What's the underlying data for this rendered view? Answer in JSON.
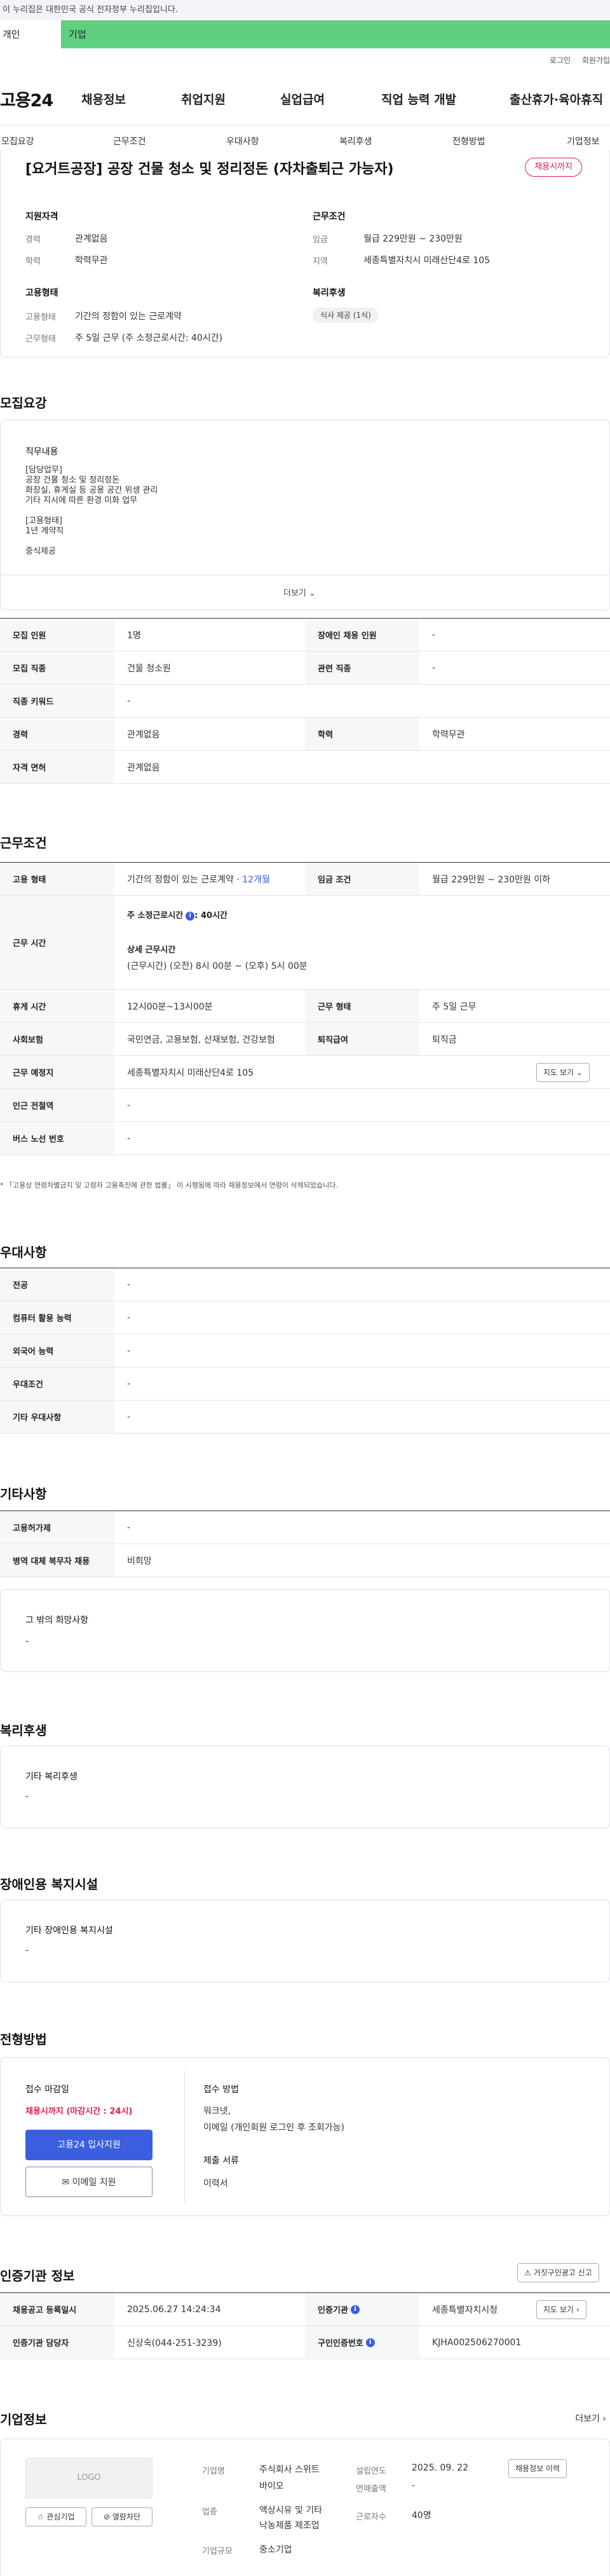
{
  "top": {
    "gov_notice": "이 누리집은 대한민국 공식 전자정부 누리집입니다.",
    "tab_user": "개인",
    "tab_biz": "기업"
  },
  "util": {
    "login": "로그인",
    "join": "회원가입"
  },
  "gnb": {
    "logo": "고용24",
    "items": [
      "채용정보",
      "취업지원",
      "실업급여",
      "직업 능력 개발",
      "출산휴가·육아휴직"
    ]
  },
  "snb": {
    "items": [
      "모집요강",
      "근무조건",
      "우대사항",
      "복리후생",
      "전형방법",
      "기업정보"
    ]
  },
  "summary": {
    "title": "[요거트공장] 공장 건물 청소 및 정리정돈 (자차출퇴근 가능자)",
    "deadline_badge": "채용시까지",
    "qual_label": "지원자격",
    "career_k": "경력",
    "career_v": "관계없음",
    "edu_k": "학력",
    "edu_v": "학력무관",
    "cond_label": "근무조건",
    "wage_k": "임금",
    "wage_v": "월급 229만원 ~ 230만원",
    "area_k": "지역",
    "area_v": "세종특별자치시 미래산단4로 105",
    "emp_label": "고용형태",
    "emptype_k": "고용형태",
    "emptype_v": "기간의 정함이 있는 근로계약",
    "worktype_k": "근무형태",
    "worktype_v": "주 5일 근무 (주 소정근로시간: 40시간)",
    "welfare_label": "복리후생",
    "welfare_chip": "식사 제공 (1식)"
  },
  "recruit": {
    "heading": "모집요강",
    "duty_label": "직무내용",
    "duty_lines": [
      "[담당업무]",
      "공장 건물 청소 및 정리정돈",
      "화장실, 휴게실 등 공용 공간 위생 관리",
      "기타 지시에 따른 환경 미화 업무",
      "",
      "[고용형태]",
      "1년 계약직",
      "",
      "중식제공"
    ],
    "more": "더보기",
    "rows": [
      [
        "모집 인원",
        "1명",
        "장애인 채용 인원",
        "-"
      ],
      [
        "모집 직종",
        "건물 청소원",
        "관련 직종",
        "-"
      ],
      [
        "직종 키워드",
        "-"
      ],
      [
        "경력",
        "관계없음",
        "학력",
        "학력무관"
      ],
      [
        "자격 면허",
        "관계없음"
      ]
    ]
  },
  "work": {
    "heading": "근무조건",
    "emp_k": "고용 형태",
    "emp_v": "기간의 정함이 있는 근로계약 ·",
    "emp_months": "12개월",
    "wage_k": "임금 조건",
    "wage_v": "월급 229만원 ~ 230만원 이하",
    "time_k": "근무 시간",
    "time_weekly": "주 소정근로시간",
    "time_weekly_v": ": 40시간",
    "time_detail_label": "상세 근무시간",
    "time_detail": "(근무시간) (오전) 8시 00분 ~ (오후) 5시 00분",
    "rows": [
      [
        "휴게 시간",
        "12시00분~13시00분",
        "근무 형태",
        "주 5일 근무"
      ],
      [
        "사회보험",
        "국민연금, 고용보험, 산재보험, 건강보험",
        "퇴직급여",
        "퇴직금"
      ]
    ],
    "place_k": "근무 예정지",
    "place_v": "세종특별자치시 미래산단4로 105",
    "map_btn": "지도 보기",
    "rows2": [
      [
        "인근 전철역",
        "-"
      ],
      [
        "버스 노선 번호",
        "-"
      ]
    ],
    "note": "* 「고용상 연령차별금지 및 고령자 고용촉진에 관한 법률」 이 시행됨에 따라 채용정보에서 연령이 삭제되었습니다."
  },
  "pref": {
    "heading": "우대사항",
    "rows": [
      [
        "전공",
        "-"
      ],
      [
        "컴퓨터 활용 능력",
        "-"
      ],
      [
        "외국어 능력",
        "-"
      ],
      [
        "우대조건",
        "-"
      ],
      [
        "기타 우대사항",
        "-"
      ]
    ]
  },
  "etc": {
    "heading": "기타사항",
    "rows": [
      [
        "고용허가제",
        "-"
      ],
      [
        "병역 대체 복무자 채용",
        "비희망"
      ]
    ],
    "other_label": "그 밖의 희망사항",
    "other_v": "-"
  },
  "welfare": {
    "heading": "복리후생",
    "label": "기타 복리후생",
    "value": "-"
  },
  "disab": {
    "heading": "장애인용 복지시설",
    "label": "기타 장애인용 복지시설",
    "value": "-"
  },
  "select": {
    "heading": "전형방법",
    "deadline_label": "접수 마감일",
    "deadline_v": "채용시까지 (마감시간 : 24시)",
    "apply_btn": "고용24 입사지원",
    "email_btn": "이메일 지원",
    "method_label": "접수 방법",
    "method_v1": "워크넷,",
    "method_v2": "이메일 (개인회원 로그인 후 조회가능)",
    "docs_label": "제출 서류",
    "docs_v": "이력서"
  },
  "cert": {
    "heading": "인증기관 정보",
    "report_btn": "거짓구인광고 신고",
    "reg_k": "채용공고 등록일시",
    "reg_v": "2025.06.27 14:24:34",
    "org_k": "인증기관",
    "org_v": "세종특별자치시청",
    "map_btn": "지도 보기",
    "mgr_k": "인증기관 담당자",
    "mgr_v": "신상숙(044-251-3239)",
    "no_k": "구인인증번호",
    "no_v": "KJHA002506270001"
  },
  "company": {
    "heading": "기업정보",
    "more": "더보기",
    "logo": "LOGO",
    "fav_btn": "관심기업",
    "block_btn": "열람차단",
    "name_k": "기업명",
    "name_v1": "주식회사 스위트",
    "name_v2": "바이오",
    "est_k": "설립연도",
    "est_v": "2025. 09. 22",
    "info_btn": "채용정보 이력",
    "sales_k": "연매출액",
    "sales_v": "-",
    "ind_k": "업종",
    "ind_v1": "액상시유 및 기타",
    "ind_v2": "낙농제품 제조업",
    "emp_k": "근로자수",
    "emp_v": "40명",
    "size_k": "기업규모",
    "size_v": "중소기업"
  },
  "colors": {
    "accent": "#3b5ee0",
    "green": "#5ed07f",
    "red": "#e0204a"
  }
}
